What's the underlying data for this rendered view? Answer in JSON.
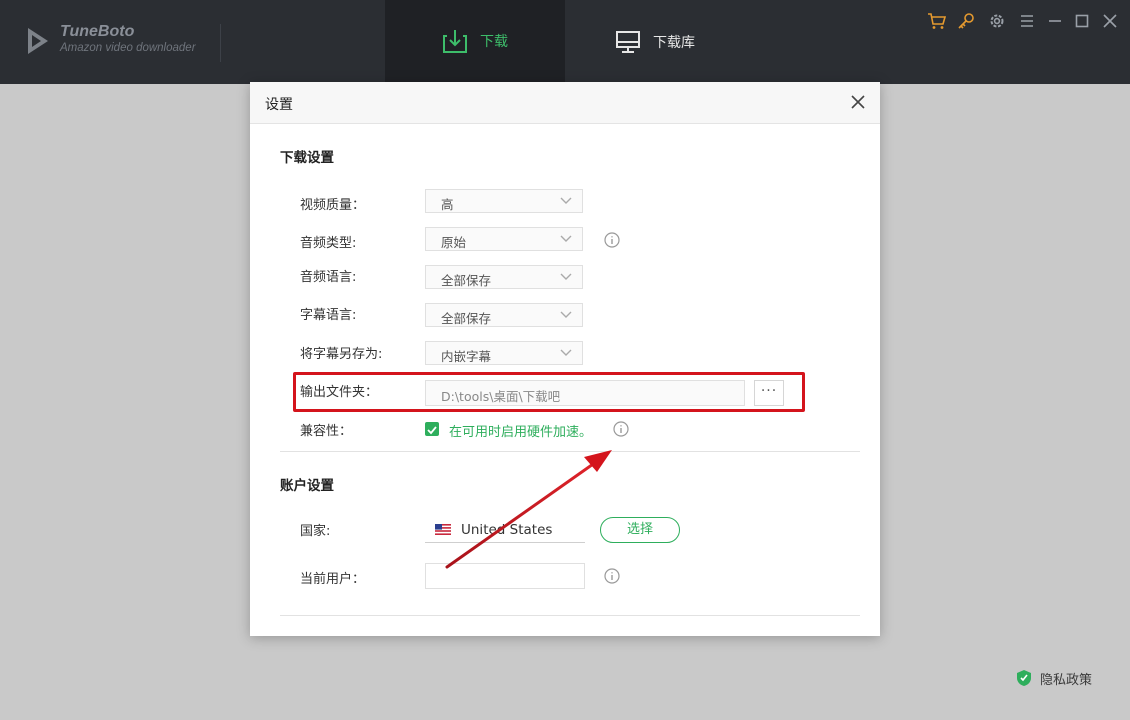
{
  "app": {
    "name": "TuneBoto",
    "subtitle": "Amazon video downloader"
  },
  "tabs": [
    {
      "label": "下载",
      "active": true,
      "icon": "download-icon"
    },
    {
      "label": "下载库",
      "active": false,
      "icon": "monitor-icon"
    }
  ],
  "window_controls": [
    "cart-icon",
    "key-icon",
    "gear-icon",
    "menu-icon",
    "minimize-icon",
    "maximize-icon",
    "close-icon"
  ],
  "colors": {
    "accent_green": "#2eae5c",
    "orange": "#e59a2f",
    "topbar": "#2b2e33",
    "annotation_red": "#d4141c"
  },
  "dialog": {
    "title": "设置",
    "download_section": {
      "title": "下载设置",
      "video_quality": {
        "label": "视频质量：",
        "value": "高"
      },
      "audio_type": {
        "label": "音频类型:",
        "value": "原始"
      },
      "audio_language": {
        "label": "音频语言:",
        "value": "全部保存"
      },
      "subtitle_language": {
        "label": "字幕语言:",
        "value": "全部保存"
      },
      "save_subtitle_as": {
        "label": "将字幕另存为:",
        "value": "内嵌字幕"
      },
      "output_folder": {
        "label": "输出文件夹：",
        "value": "D:\\tools\\桌面\\下载吧",
        "browse": "···"
      },
      "compatibility": {
        "label": "兼容性：",
        "checkbox_text": "在可用时启用硬件加速。",
        "checked": true
      }
    },
    "account_section": {
      "title": "账户设置",
      "country": {
        "label": "国家:",
        "value": "United States",
        "button": "选择"
      },
      "current_user": {
        "label": "当前用户：",
        "value": ""
      }
    }
  },
  "footer": {
    "privacy": "隐私政策"
  }
}
